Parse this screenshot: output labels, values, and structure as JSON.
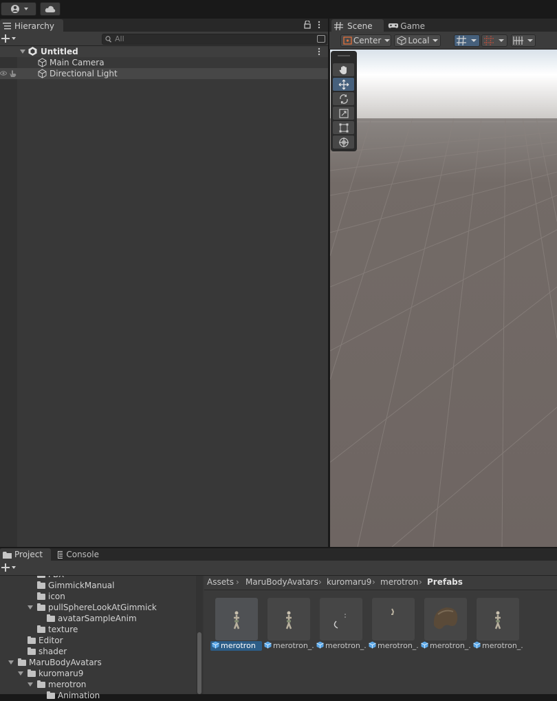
{
  "hierarchy": {
    "tab_label": "Hierarchy",
    "search_placeholder": "All",
    "scene_name": "Untitled",
    "objects": [
      "Main Camera",
      "Directional Light"
    ]
  },
  "scene_view": {
    "tabs": [
      "Scene",
      "Game"
    ],
    "pivot_mode": "Center",
    "pivot_rotation": "Local"
  },
  "project": {
    "tabs": [
      "Project",
      "Console"
    ],
    "tree": [
      {
        "label": "FBX",
        "depth": 2,
        "expanded": null
      },
      {
        "label": "GimmickManual",
        "depth": 2,
        "expanded": null
      },
      {
        "label": "icon",
        "depth": 2,
        "expanded": null
      },
      {
        "label": "pullSphereLookAtGimmick",
        "depth": 2,
        "expanded": true
      },
      {
        "label": "avatarSampleAnim",
        "depth": 3,
        "expanded": null
      },
      {
        "label": "texture",
        "depth": 2,
        "expanded": null
      },
      {
        "label": "Editor",
        "depth": 1,
        "expanded": null
      },
      {
        "label": "shader",
        "depth": 1,
        "expanded": null
      },
      {
        "label": "MaruBodyAvatars",
        "depth": 0,
        "expanded": true
      },
      {
        "label": "kuromaru9",
        "depth": 1,
        "expanded": true
      },
      {
        "label": "merotron",
        "depth": 2,
        "expanded": true
      },
      {
        "label": "Animation",
        "depth": 3,
        "expanded": null
      }
    ],
    "breadcrumb": [
      "Assets",
      "MaruBodyAvatars",
      "kuromaru9",
      "merotron",
      "Prefabs"
    ],
    "assets": [
      "merotron",
      "merotron_...",
      "merotron_...",
      "merotron_...",
      "merotron_...",
      "merotron_..."
    ]
  },
  "colors": {
    "selection": "#2c5d87",
    "tool_active": "#46607c",
    "sky": "#ffffff",
    "ground": "#6f6662"
  }
}
